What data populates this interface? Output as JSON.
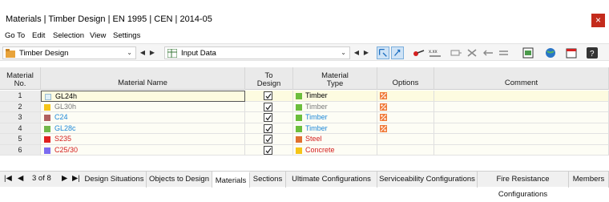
{
  "window": {
    "title": "Materials | Timber Design | EN 1995 | CEN | 2014-05",
    "close_glyph": "×"
  },
  "menu": [
    "Go To",
    "Edit",
    "Selection",
    "View",
    "Settings"
  ],
  "toolbar": {
    "module_combo": "Timber Design",
    "data_combo": "Input Data",
    "icons": [
      "select-window-icon",
      "select-object-icon",
      "pick-icon",
      "coordinates-icon",
      "filter-icon",
      "delete-all-icon",
      "move-left-icon",
      "move-right-icon",
      "export-icon",
      "globe-icon",
      "report-icon",
      "help-icon"
    ]
  },
  "table": {
    "headers": {
      "no": [
        "Material",
        "No."
      ],
      "name": "Material Name",
      "design": [
        "To",
        "Design"
      ],
      "type": [
        "Material",
        "Type"
      ],
      "options": "Options",
      "comment": "Comment"
    },
    "rows": [
      {
        "no": "1",
        "name": "GL24h",
        "color": "#e0f0f8",
        "name_color": "#000000",
        "design": true,
        "type": "Timber",
        "type_color": "#000000",
        "type_swatch": "#6cbe3c",
        "option": true,
        "selected": true
      },
      {
        "no": "2",
        "name": "GL30h",
        "color": "#f5c518",
        "name_color": "#7a7a7a",
        "design": true,
        "type": "Timber",
        "type_color": "#7a7a7a",
        "type_swatch": "#6cbe3c",
        "option": true,
        "selected": false
      },
      {
        "no": "3",
        "name": "C24",
        "color": "#b06060",
        "name_color": "#1e88d8",
        "design": true,
        "type": "Timber",
        "type_color": "#1e88d8",
        "type_swatch": "#6cbe3c",
        "option": true,
        "selected": false
      },
      {
        "no": "4",
        "name": "GL28c",
        "color": "#72b84a",
        "name_color": "#1e88d8",
        "design": true,
        "type": "Timber",
        "type_color": "#1e88d8",
        "type_swatch": "#6cbe3c",
        "option": true,
        "selected": false
      },
      {
        "no": "5",
        "name": "S235",
        "color": "#e02020",
        "name_color": "#d42020",
        "design": true,
        "type": "Steel",
        "type_color": "#d42020",
        "type_swatch": "#e07030",
        "option": false,
        "selected": false
      },
      {
        "no": "6",
        "name": "C25/30",
        "color": "#7c6cf0",
        "name_color": "#d42020",
        "design": true,
        "type": "Concrete",
        "type_color": "#d42020",
        "type_swatch": "#f5c518",
        "option": false,
        "selected": false
      }
    ]
  },
  "tabs": {
    "pager": "3 of 8",
    "items": [
      "Design Situations",
      "Objects to Design",
      "Materials",
      "Sections",
      "Ultimate Configurations",
      "Serviceability Configurations",
      "Fire Resistance Configurations",
      "Members"
    ],
    "active": "Materials"
  }
}
